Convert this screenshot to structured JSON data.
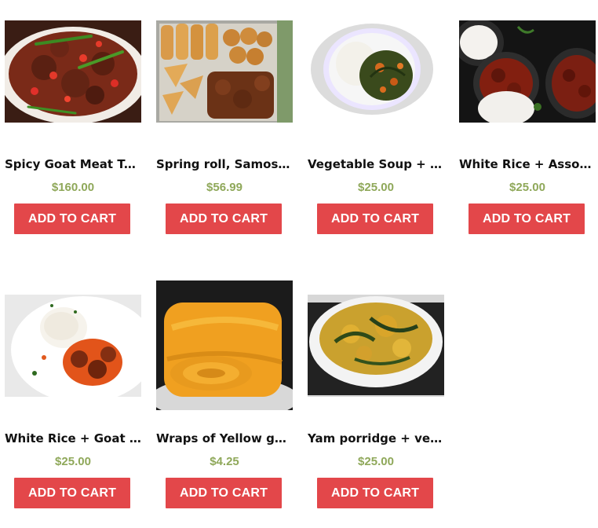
{
  "colors": {
    "accent": "#e3474a",
    "price": "#8fa85a",
    "title": "#111111"
  },
  "products": [
    {
      "image_icon": "spicy-goat-meat-image",
      "name": "Spicy Goat Meat Tray",
      "price": "$160.00",
      "cta": "ADD TO CART"
    },
    {
      "image_icon": "spring-roll-samosa-image",
      "name": "Spring roll, Samosa,...",
      "price": "$56.99",
      "cta": "ADD TO CART"
    },
    {
      "image_icon": "vegetable-soup-image",
      "name": "Vegetable Soup + P...",
      "price": "$25.00",
      "cta": "ADD TO CART"
    },
    {
      "image_icon": "white-rice-assorted-image",
      "name": "White Rice + Assort...",
      "price": "$25.00",
      "cta": "ADD TO CART"
    },
    {
      "image_icon": "white-rice-goat-image",
      "name": "White Rice + Goat ...",
      "price": "$25.00",
      "cta": "ADD TO CART"
    },
    {
      "image_icon": "yellow-garri-wrap-image",
      "name": "Wraps of Yellow garri",
      "price": "$4.25",
      "cta": "ADD TO CART"
    },
    {
      "image_icon": "yam-porridge-image",
      "name": "Yam porridge + veg...",
      "price": "$25.00",
      "cta": "ADD TO CART"
    }
  ]
}
